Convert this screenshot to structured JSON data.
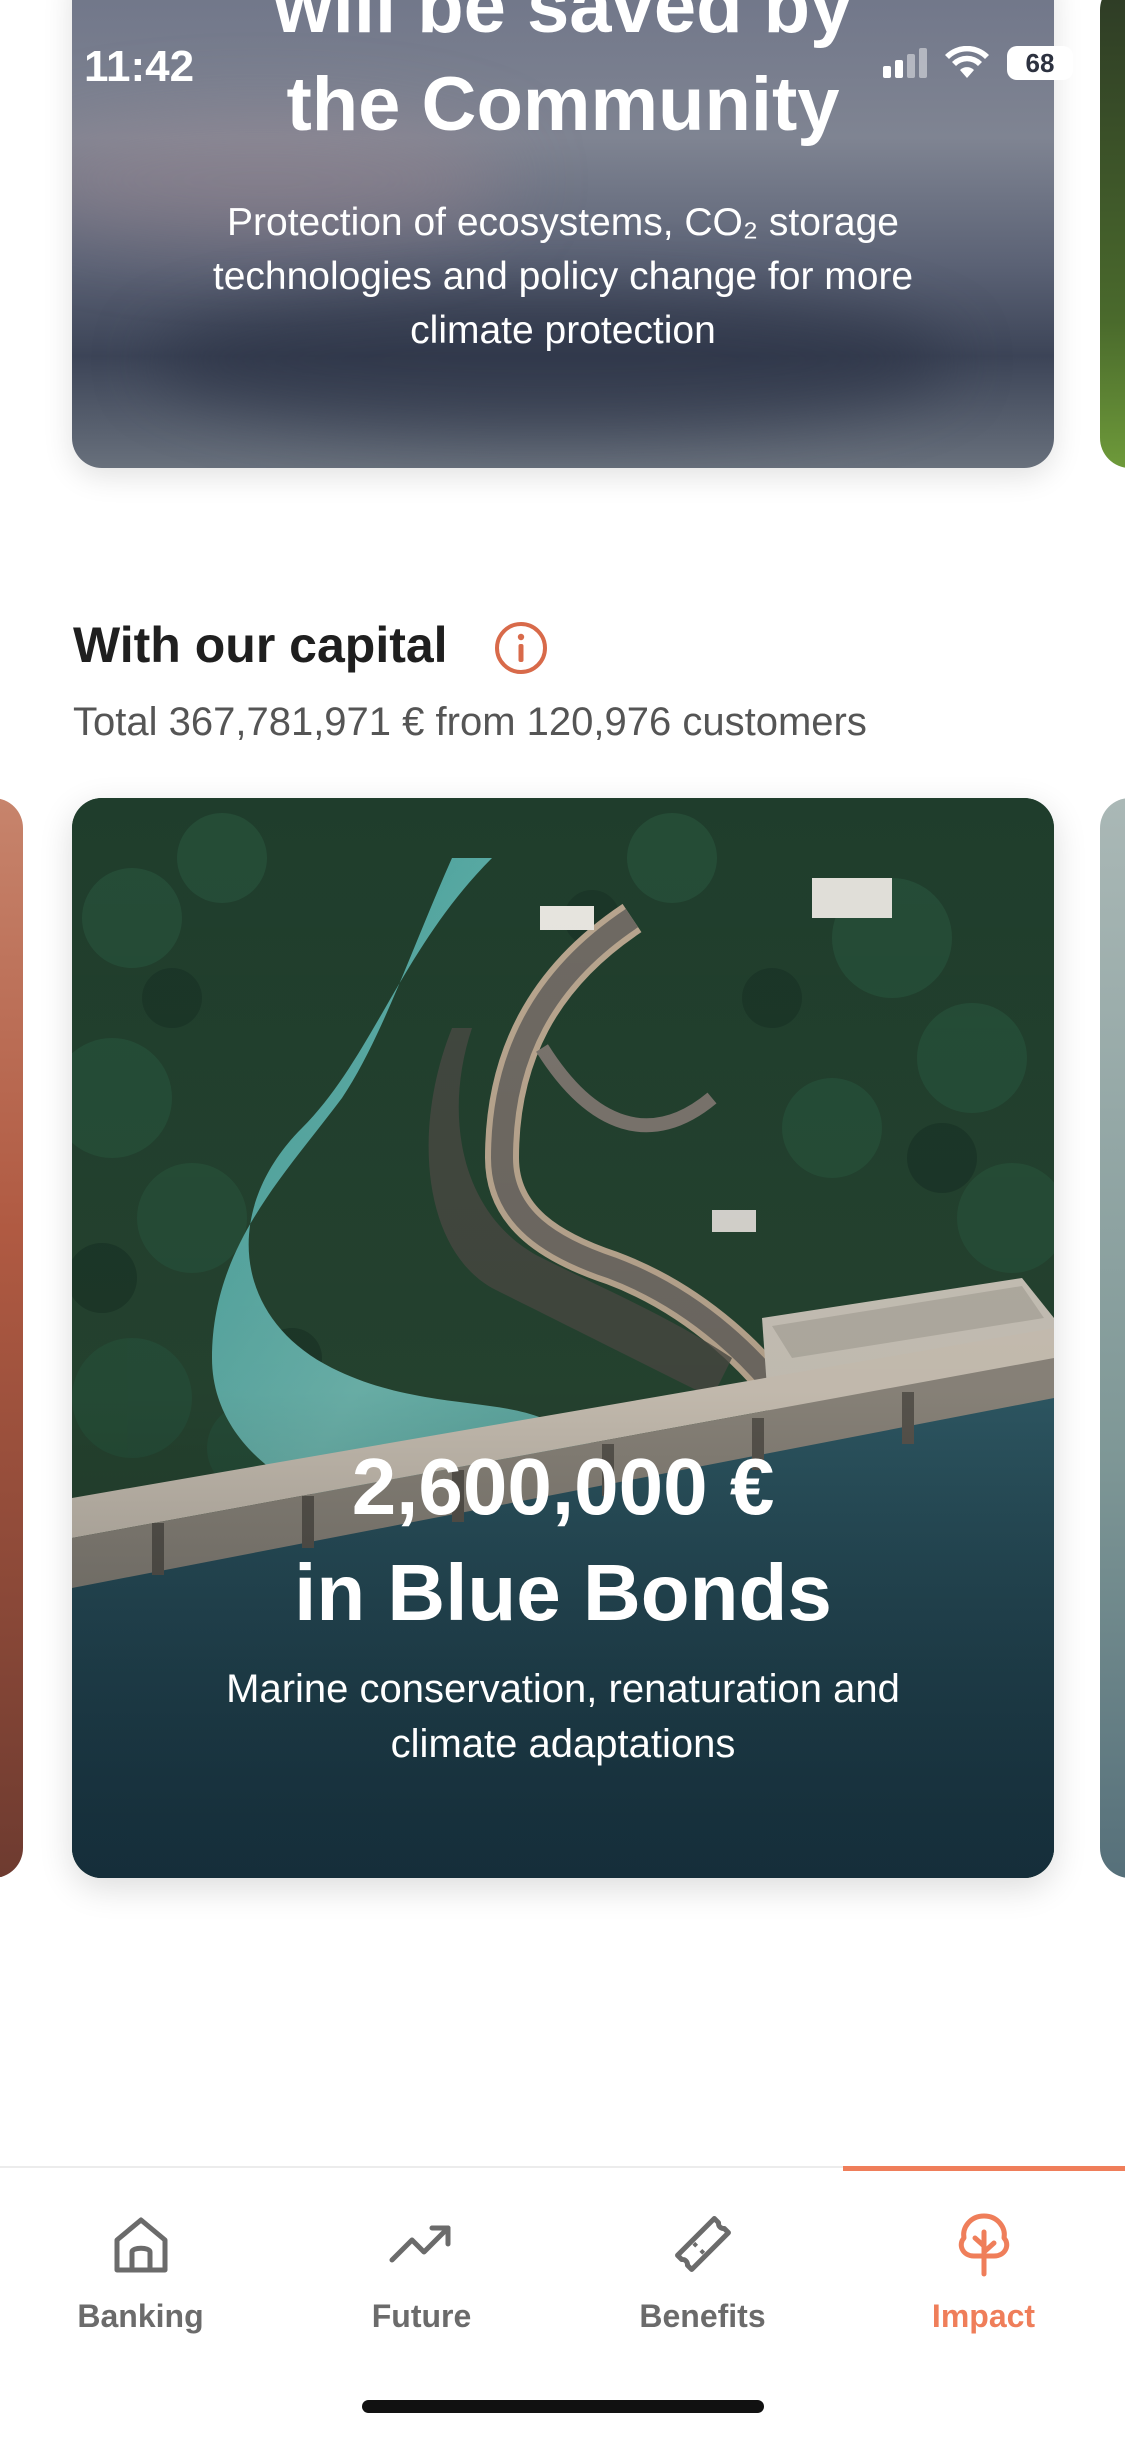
{
  "status_bar": {
    "time": "11:42",
    "battery": "68"
  },
  "top_card": {
    "title_line1": "will be saved by",
    "title_line2": "the Community",
    "subtitle": "Protection of ecosystems, CO₂ storage technologies and policy change for more climate protection"
  },
  "capital_section": {
    "title": "With our capital",
    "summary": "Total 367,781,971 € from 120,976 customers"
  },
  "featured_card": {
    "amount": "2,600,000 €",
    "title": "in Blue Bonds",
    "subtitle": "Marine conservation, renaturation and climate adaptations"
  },
  "tab_bar": {
    "tabs": [
      {
        "label": "Banking",
        "icon": "home-icon"
      },
      {
        "label": "Future",
        "icon": "trend-up-icon"
      },
      {
        "label": "Benefits",
        "icon": "ticket-icon"
      },
      {
        "label": "Impact",
        "icon": "tree-icon"
      }
    ],
    "active": "Impact"
  },
  "colors": {
    "accent": "#ef7e5a",
    "info_icon": "#d86a4a",
    "inactive_tab": "#6b6b6b"
  }
}
